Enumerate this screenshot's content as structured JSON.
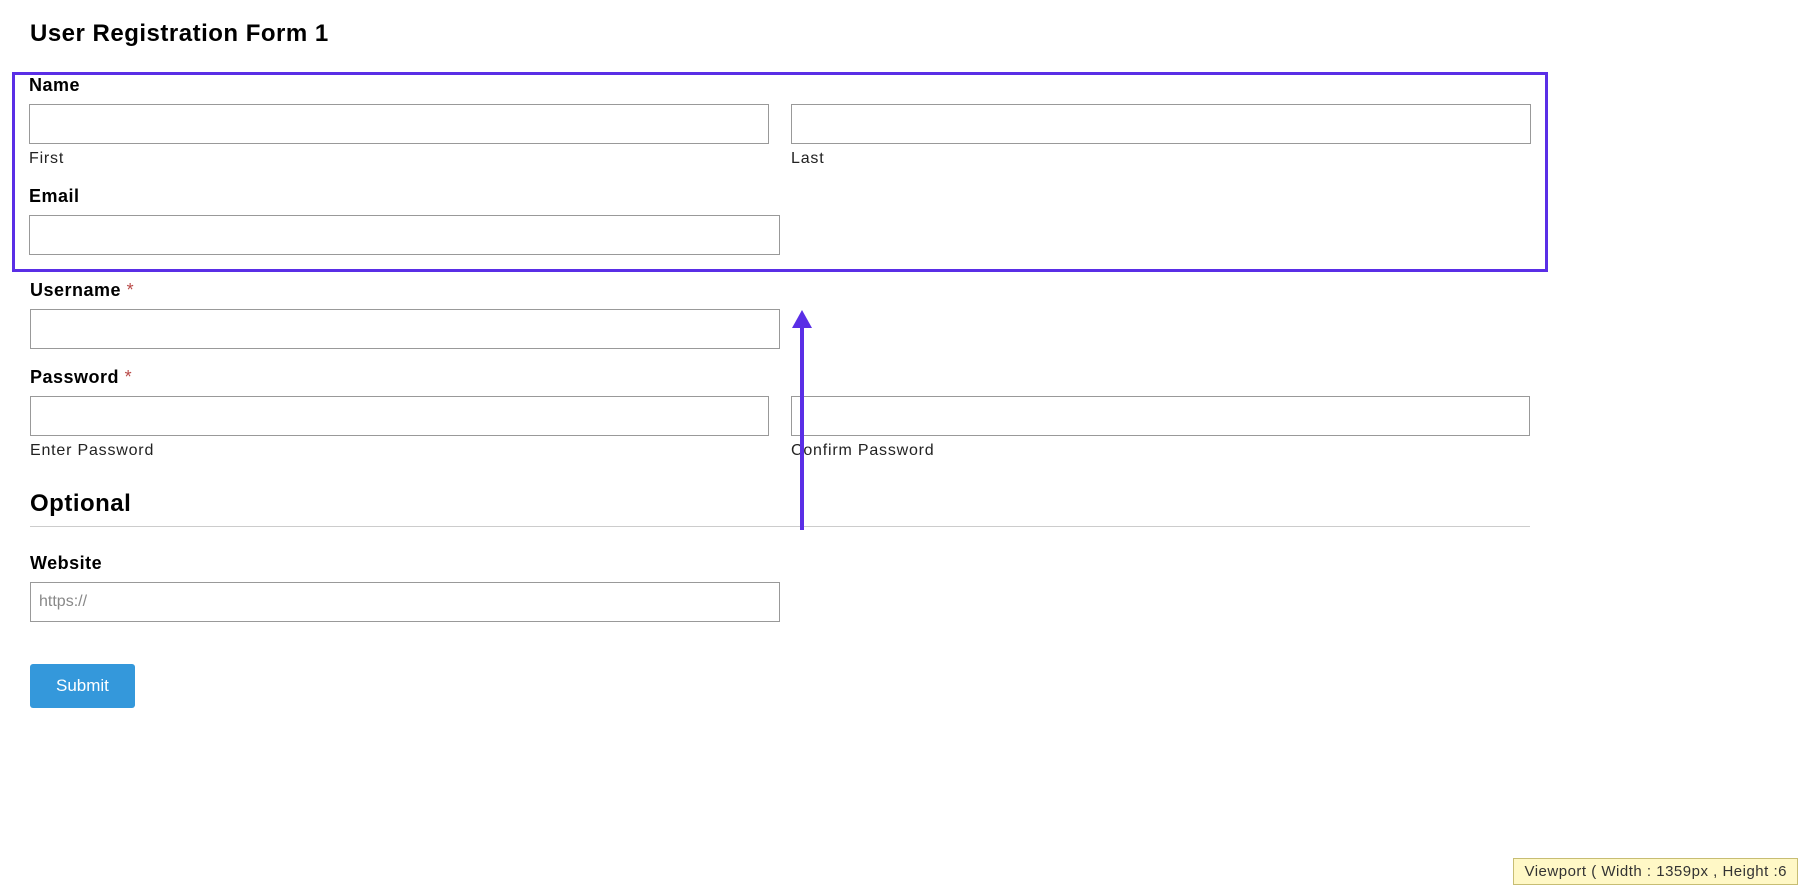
{
  "form": {
    "title": "User Registration Form 1",
    "name": {
      "label": "Name",
      "first_sub": "First",
      "last_sub": "Last",
      "first_value": "",
      "last_value": ""
    },
    "email": {
      "label": "Email",
      "value": ""
    },
    "username": {
      "label": "Username",
      "required_mark": "*",
      "value": ""
    },
    "password": {
      "label": "Password",
      "required_mark": "*",
      "enter_sub": "Enter Password",
      "confirm_sub": "Confirm Password",
      "enter_value": "",
      "confirm_value": ""
    },
    "optional_heading": "Optional",
    "website": {
      "label": "Website",
      "placeholder": "https://",
      "value": ""
    },
    "submit_label": "Submit"
  },
  "viewport_badge": "Viewport ( Width : 1359px , Height :6",
  "annotation": {
    "arrow_color": "#5a2ee6",
    "highlight_color": "#5a2ee6"
  }
}
